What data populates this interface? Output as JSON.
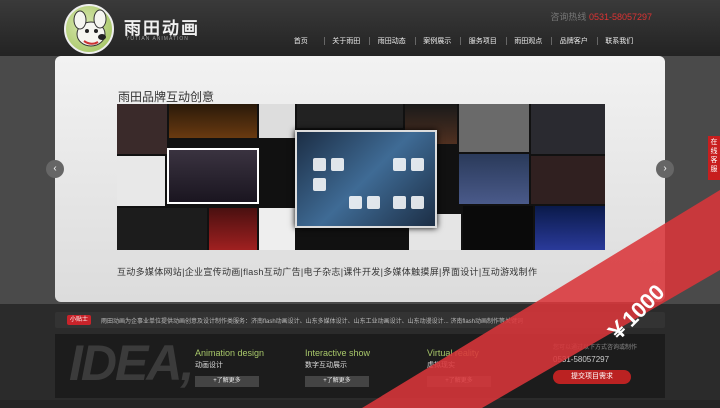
{
  "header": {
    "logo_text": "雨田动画",
    "logo_sub": "YUTIAN ANIMATION",
    "hotline_label": "咨询热线",
    "hotline_number": "0531-58057297"
  },
  "nav": [
    "首页",
    "关于雨田",
    "雨田动态",
    "案例展示",
    "服务项目",
    "雨田观点",
    "品牌客户",
    "联系我们"
  ],
  "banner": {
    "title": "雨田品牌互动创意",
    "services": "互动多媒体网站|企业宣传动画|flash互动广告|电子杂志|课件开发|多媒体触摸屏|界面设计|互动游戏制作",
    "prev": "‹",
    "next": "›"
  },
  "side_tab": "在线客服",
  "ticker": {
    "tag": "小贴士",
    "message": "雨田动画为企事业单位提供动画创意及设计制作类服务：济南flash动画设计、山东多媒体设计、山东工业动画设计、山东动漫设计... 济南flash动画制作等关键词"
  },
  "bottom": {
    "watermark": "IDEA,",
    "items": [
      {
        "en": "Animation design",
        "cn": "动画设计",
        "more": "+了解更多"
      },
      {
        "en": "Interactive show",
        "cn": "数字互动展示",
        "more": "+了解更多"
      },
      {
        "en": "Virtual reality",
        "cn": "虚拟现实",
        "more": "+了解更多"
      }
    ],
    "contact_q": "您可以通过以下方式咨询或制作",
    "contact_phone": "0531-58057297",
    "contact_btn": "提交项目需求"
  },
  "price_tag": "￥1000",
  "colors": {
    "accent": "#c8232a",
    "ribbon": "#d9353a",
    "green": "#a8c86a"
  }
}
